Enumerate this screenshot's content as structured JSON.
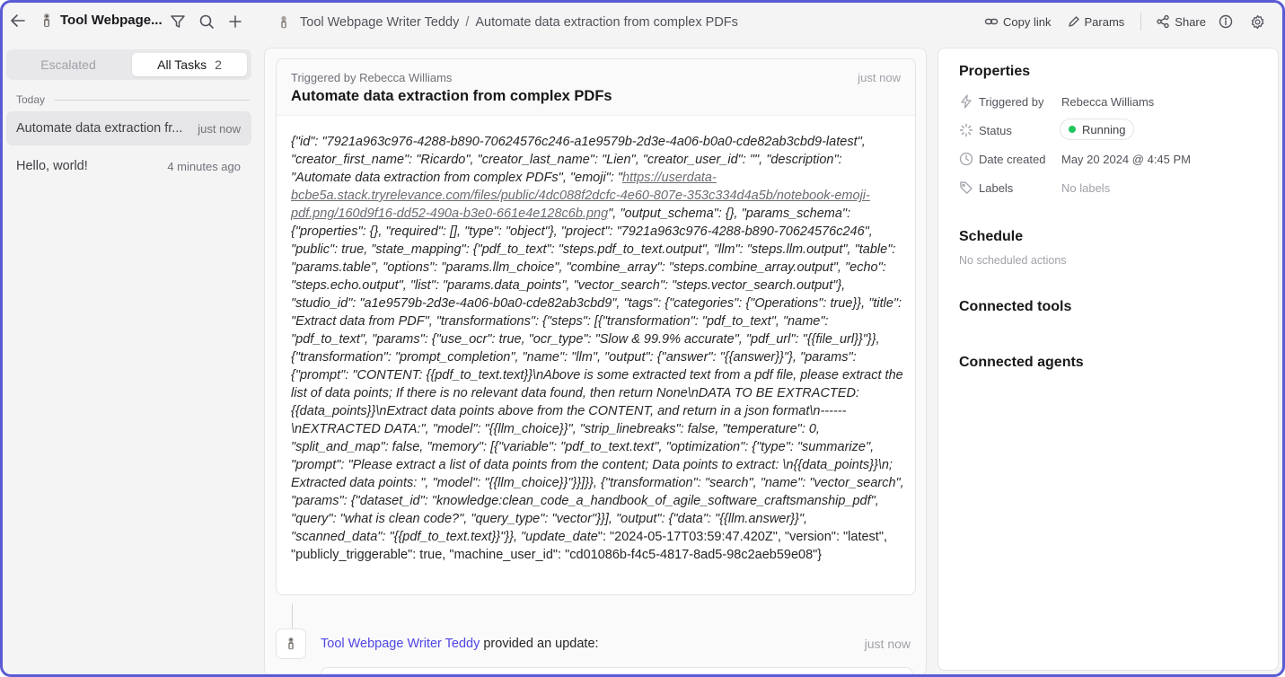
{
  "colors": {
    "accent": "#5b5bd6",
    "agent_link": "#4f46e5",
    "status_running": "#22c55e"
  },
  "agent": {
    "name": "Tool Webpage...",
    "full_name": "Tool Webpage Writer Teddy"
  },
  "breadcrumb": {
    "agent": "Tool Webpage Writer Teddy",
    "separator": "/",
    "task": "Automate data extraction from complex PDFs"
  },
  "actions": {
    "copy_link": "Copy link",
    "params": "Params",
    "share": "Share"
  },
  "sidebar": {
    "tabs": {
      "escalated": "Escalated",
      "all_tasks": "All Tasks",
      "all_tasks_count": "2"
    },
    "group_label": "Today",
    "tasks": [
      {
        "title": "Automate data extraction fr...",
        "time": "just now"
      },
      {
        "title": "Hello, world!",
        "time": "4 minutes ago"
      }
    ]
  },
  "main": {
    "card": {
      "triggered_by": "Triggered by Rebecca Williams",
      "time": "just now",
      "title": "Automate data extraction from complex PDFs",
      "body_part1": "{\"id\": \"7921a963c976-4288-b890-70624576c246-a1e9579b-2d3e-4a06-b0a0-cde82ab3cbd9-latest\", \"creator_first_name\": \"Ricardo\", \"creator_last_name\": \"Lien\", \"creator_user_id\": \"\", \"description\": \"Automate data extraction from complex PDFs\", \"emoji\": \"",
      "emoji_link": "https://userdata-bcbe5a.stack.tryrelevance.com/files/public/4dc088f2dcfc-4e60-807e-353c334d4a5b/notebook-emoji-pdf.png/160d9f16-dd52-490a-b3e0-661e4e128c6b.png",
      "body_part2": "\", \"output_schema\": {}, \"params_schema\": {\"properties\": {}, \"required\": [], \"type\": \"object\"}, \"project\": \"7921a963c976-4288-b890-70624576c246\", \"public\": true, \"state_mapping\": {\"pdf_to_text\": \"steps.pdf_to_text.output\", \"llm\": \"steps.llm.output\", \"table\": \"params.table\", \"options\": \"params.llm_choice\", \"combine_array\": \"steps.combine_array.output\", \"echo\": \"steps.echo.output\", \"list\": \"params.data_points\", \"vector_search\": \"steps.vector_search.output\"}, \"studio_id\": \"a1e9579b-2d3e-4a06-b0a0-cde82ab3cbd9\", \"tags\": {\"categories\": {\"Operations\": true}}, \"title\": \"Extract data from PDF\", \"transformations\": {\"steps\": [{\"transformation\": \"pdf_to_text\", \"name\": \"pdf_to_text\", \"params\": {\"use_ocr\": true, \"ocr_type\": \"Slow & 99.9% accurate\", \"pdf_url\": \"{{file_url}}\"}}, {\"transformation\": \"prompt_completion\", \"name\": \"llm\", \"output\": {\"answer\": \"{{answer}}\"}, \"params\": {\"prompt\": \"CONTENT: {{pdf_to_text.text}}\\nAbove is some extracted text from a pdf file, please extract the list of data points; If there is no relevant data found, then return None\\nDATA TO BE EXTRACTED: {{data_points}}\\nExtract data points above from the CONTENT, and return in a json format\\n------\\nEXTRACTED DATA:\", \"model\": \"{{llm_choice}}\", \"strip_linebreaks\": false, \"temperature\": 0, \"split_and_map\": false, \"memory\": [{\"variable\": \"pdf_to_text.text\", \"optimization\": {\"type\": \"summarize\", \"prompt\": \"Please extract a list of data points from the content; Data points to extract: \\n{{data_points}}\\n; Extracted data points: \", \"model\": \"{{llm_choice}}\"}}]}}, {\"transformation\": \"search\", \"name\": \"vector_search\", \"params\": {\"dataset_id\": \"knowledge:clean_code_a_handbook_of_agile_software_craftsmanship_pdf\", \"query\": \"what is clean code?\", \"query_type\": \"vector\"}}], \"output\": {\"data\": \"{{llm.answer}}\", \"scanned_data\": \"{{pdf_to_text.text}}\"}}, \"update_date",
      "body_part3": "\": \"2024-05-17T03:59:47.420Z\", \"version\": \"latest\", \"publicly_triggerable\": true, \"machine_user_id\": \"cd01086b-f4c5-4817-8ad5-98c2aeb59e08\"}"
    },
    "update": {
      "agent": "Tool Webpage Writer Teddy",
      "text": " provided an update:",
      "time": "just now"
    }
  },
  "properties": {
    "title": "Properties",
    "triggered_by": {
      "label": "Triggered by",
      "value": "Rebecca Williams"
    },
    "status": {
      "label": "Status",
      "value": "Running"
    },
    "date_created": {
      "label": "Date created",
      "value": "May 20 2024 @ 4:45 PM"
    },
    "labels": {
      "label": "Labels",
      "value": "No labels"
    }
  },
  "schedule": {
    "title": "Schedule",
    "empty": "No scheduled actions"
  },
  "connected_tools": {
    "title": "Connected tools"
  },
  "connected_agents": {
    "title": "Connected agents"
  },
  "icons": [
    "back-arrow-icon",
    "agent-avatar-icon",
    "filter-icon",
    "search-icon",
    "plus-icon",
    "link-icon",
    "pencil-icon",
    "share-icon",
    "info-icon",
    "gear-icon",
    "lightning-icon",
    "spinner-icon",
    "clock-icon",
    "tag-icon"
  ]
}
